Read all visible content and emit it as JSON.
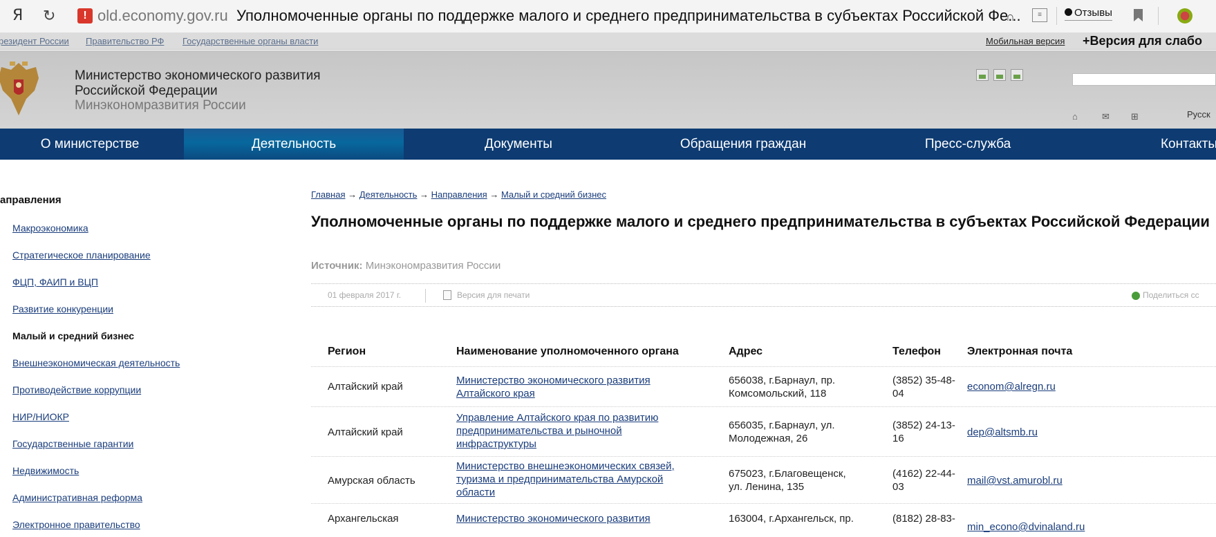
{
  "browser": {
    "logo": "Я",
    "reload": "↻",
    "warning": "!",
    "domain": "old.economy.gov.ru",
    "title": "Уполномоченные органы по поддержке малого и среднего предпринимательства в субъектах Российской Фе...",
    "reviews_label": "Отзывы"
  },
  "top_links": {
    "president": "резидент России",
    "government": "Правительство РФ",
    "authorities": "Государственные органы власти",
    "mobile": "Мобильная версия",
    "impaired": "+Версия для слабо"
  },
  "header": {
    "line1": "Министерство экономического развития",
    "line2": "Российской Федерации",
    "short": "Минэкономразвития России",
    "lang": "Русск"
  },
  "nav": [
    {
      "label": "О министерстве"
    },
    {
      "label": "Деятельность"
    },
    {
      "label": "Документы"
    },
    {
      "label": "Обращения граждан"
    },
    {
      "label": "Пресс-служба"
    },
    {
      "label": "Контакты"
    }
  ],
  "sidebar": {
    "title": "аправления",
    "items": [
      {
        "label": "Макроэкономика"
      },
      {
        "label": "Стратегическое планирование"
      },
      {
        "label": "ФЦП, ФАИП и ВЦП"
      },
      {
        "label": "Развитие конкуренции"
      },
      {
        "label": "Малый и средний бизнес"
      },
      {
        "label": "Внешнеэкономическая деятельность"
      },
      {
        "label": "Противодействие коррупции"
      },
      {
        "label": "НИР/НИОКР"
      },
      {
        "label": "Государственные гарантии"
      },
      {
        "label": "Недвижимость"
      },
      {
        "label": "Административная реформа"
      },
      {
        "label": "Электронное правительство"
      }
    ]
  },
  "breadcrumb": {
    "home": "Главная",
    "activity": "Деятельность",
    "directions": "Направления",
    "current": "Малый и средний бизнес",
    "arrow": "→"
  },
  "article": {
    "title": "Уполномоченные органы по поддержке малого и среднего предпринимательства в субъектах Российской Федерации",
    "source_label": "Источник:",
    "source_value": "Минэкономразвития России",
    "date": "01 февраля 2017 г.",
    "print": "Версия для печати",
    "share": "Поделиться сс"
  },
  "table": {
    "headers": [
      "Регион",
      "Наименование уполномоченного органа",
      "Адрес",
      "Телефон",
      "Электронная почта"
    ],
    "rows": [
      {
        "region": "Алтайский край",
        "org": [
          "Министерство экономического развития",
          "Алтайского края"
        ],
        "address": [
          "656038, г.Барнаул, пр.",
          "Комсомольский, 118"
        ],
        "phone": [
          "(3852) 35-48-",
          "04"
        ],
        "email": "econom@alregn.ru"
      },
      {
        "region": "Алтайский край",
        "org": [
          "Управление Алтайского края по развитию",
          "предпринимательства и рыночной",
          "инфраструктуры"
        ],
        "address": [
          "656035, г.Барнаул, ул.",
          "Молодежная, 26"
        ],
        "phone": [
          "(3852) 24-13-",
          "16"
        ],
        "email": "dep@altsmb.ru"
      },
      {
        "region": "Амурская область",
        "org": [
          "Министерство внешнеэкономических связей,",
          "туризма и предпринимательства Амурской",
          "области"
        ],
        "address": [
          "675023, г.Благовещенск,",
          "ул. Ленина, 135"
        ],
        "phone": [
          "(4162) 22-44-",
          "03"
        ],
        "email": "mail@vst.amurobl.ru"
      },
      {
        "region": "Архангельская",
        "org": [
          "Министерство экономического развития"
        ],
        "address": [
          "163004, г.Архангельск, пр."
        ],
        "phone": [
          "(8182) 28-83-"
        ],
        "email": "min_econo@dvinaland.ru"
      }
    ]
  }
}
